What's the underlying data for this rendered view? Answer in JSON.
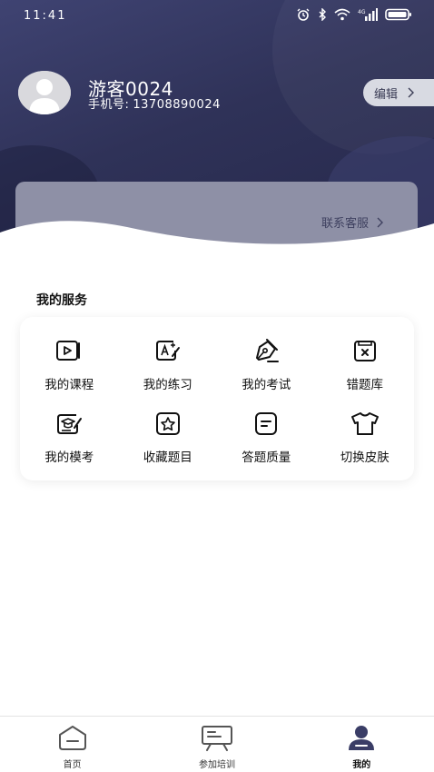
{
  "status_bar": {
    "time": "11:41",
    "network": "4G"
  },
  "profile": {
    "name": "游客0024",
    "phone_label": "手机号:",
    "phone": "13708890024",
    "edit_label": "编辑",
    "contact_label": "联系客服"
  },
  "services": {
    "title": "我的服务",
    "items": [
      {
        "label": "我的课程",
        "icon": "play-video-icon"
      },
      {
        "label": "我的练习",
        "icon": "practice-edit-icon"
      },
      {
        "label": "我的考试",
        "icon": "pen-nib-icon"
      },
      {
        "label": "错题库",
        "icon": "wrong-questions-icon"
      },
      {
        "label": "我的模考",
        "icon": "mock-exam-cap-icon"
      },
      {
        "label": "收藏题目",
        "icon": "star-icon"
      },
      {
        "label": "答题质量",
        "icon": "answer-quality-icon"
      },
      {
        "label": "切换皮肤",
        "icon": "tshirt-icon"
      }
    ]
  },
  "tabbar": {
    "tabs": [
      {
        "label": "首页",
        "icon": "home-icon",
        "active": false
      },
      {
        "label": "参加培训",
        "icon": "training-board-icon",
        "active": false
      },
      {
        "label": "我的",
        "icon": "user-icon",
        "active": true
      }
    ]
  },
  "colors": {
    "header_dark": "#2f3258",
    "accent_text": "#3f4160",
    "card_strip": "#8e90a6"
  }
}
